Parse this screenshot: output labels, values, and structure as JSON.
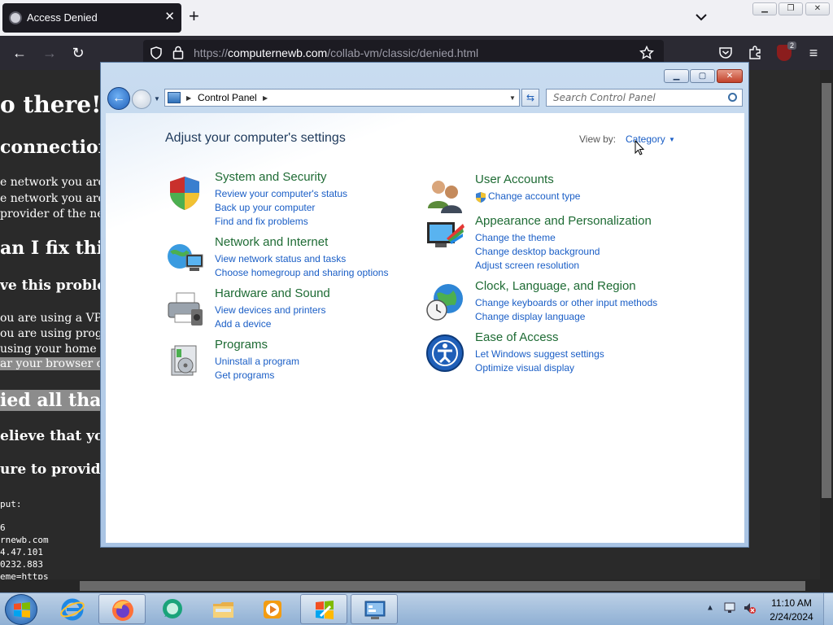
{
  "browser": {
    "tab_title": "Access Denied",
    "tab_close": "✕",
    "new_tab": "+",
    "url_scheme": "https://",
    "url_host": "computernewb.com",
    "url_path": "/collab-vm/classic/denied.html",
    "extension_badge": "2"
  },
  "page": {
    "lines": [
      "o there!",
      "connection h",
      "e network you are co",
      "e network you are co",
      " provider of the net",
      "an I fix this?",
      "ve this problem",
      "ou are using a VPN",
      "ou are using progra",
      " using your home c",
      "ar your browser cac",
      "ied all that,",
      "elieve that your",
      "ure to provide th",
      "put:",
      "6",
      "rnewb.com",
      "4.47.101",
      "0232.883",
      "eme=https"
    ]
  },
  "control_panel": {
    "breadcrumb": "Control Panel",
    "search_placeholder": "Search Control Panel",
    "heading": "Adjust your computer's settings",
    "view_by_label": "View by:",
    "view_by_value": "Category",
    "groups": [
      {
        "title": "System and Security",
        "icon": "shield-icon",
        "links": [
          "Review your computer's status",
          "Back up your computer",
          "Find and fix problems"
        ]
      },
      {
        "title": "Network and Internet",
        "icon": "network-icon",
        "links": [
          "View network status and tasks",
          "Choose homegroup and sharing options"
        ]
      },
      {
        "title": "Hardware and Sound",
        "icon": "printer-icon",
        "links": [
          "View devices and printers",
          "Add a device"
        ]
      },
      {
        "title": "Programs",
        "icon": "programs-icon",
        "links": [
          "Uninstall a program",
          "Get programs"
        ]
      },
      {
        "title": "User Accounts",
        "icon": "users-icon",
        "links": [
          "Change account type"
        ]
      },
      {
        "title": "Appearance and Personalization",
        "icon": "monitor-paint-icon",
        "links": [
          "Change the theme",
          "Change desktop background",
          "Adjust screen resolution"
        ]
      },
      {
        "title": "Clock, Language, and Region",
        "icon": "globe-clock-icon",
        "links": [
          "Change keyboards or other input methods",
          "Change display language"
        ]
      },
      {
        "title": "Ease of Access",
        "icon": "ease-of-access-icon",
        "links": [
          "Let Windows suggest settings",
          "Optimize visual display"
        ]
      }
    ]
  },
  "taskbar": {
    "time": "11:10 AM",
    "date": "2/24/2024",
    "apps": [
      "internet-explorer-icon",
      "firefox-icon",
      "chat-icon",
      "file-explorer-icon",
      "media-player-icon",
      "windows-update-icon",
      "control-panel-icon"
    ]
  }
}
